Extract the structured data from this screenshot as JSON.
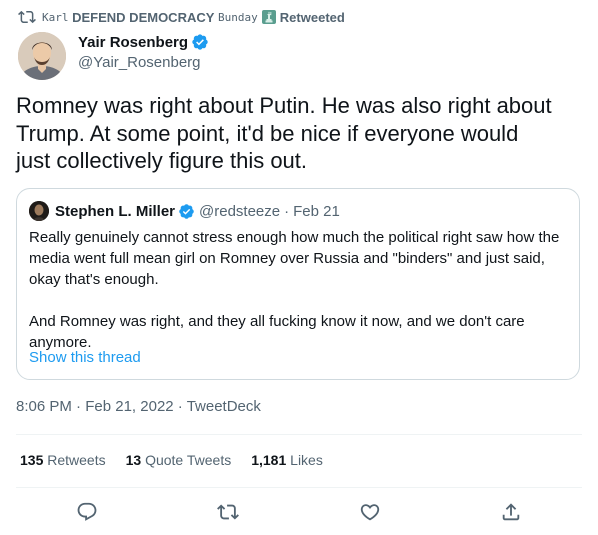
{
  "retweet_banner": {
    "name_prefix": "Karl",
    "name_main": "DEFEND DEMOCRACY",
    "name_suffix": "Bunday",
    "action": "Retweeted"
  },
  "author": {
    "name": "Yair Rosenberg",
    "handle": "@Yair_Rosenberg",
    "verified": true
  },
  "tweet": {
    "text": "Romney was right about Putin. He was also right about\nTrump. At some point, it'd be nice if everyone would\njust collectively figure this out.",
    "time": "8:06 PM",
    "date": "Feb 21, 2022",
    "source": "TweetDeck",
    "separator": "·"
  },
  "quoted": {
    "name": "Stephen L. Miller",
    "handle": "@redsteeze",
    "date": "Feb 21",
    "separator": "·",
    "paragraph_1": "Really genuinely cannot stress enough how much the political right saw how the media went full mean girl on Romney over Russia and \"binders\" and just said, okay that's enough.",
    "paragraph_2": "And Romney was right, and they all fucking know it now, and we don't care anymore.",
    "thread_link": "Show this thread"
  },
  "stats": {
    "retweets_count": "135",
    "retweets_label": "Retweets",
    "quotes_count": "13",
    "quotes_label": "Quote Tweets",
    "likes_count": "1,181",
    "likes_label": "Likes"
  },
  "colors": {
    "accent": "#1d9bf0",
    "muted": "#536471",
    "text": "#0f1419",
    "border": "#cfd9de"
  },
  "icons": {
    "retweet_banner": "retweet-icon",
    "statue": "statue-of-liberty-icon",
    "verified": "verified-badge-icon",
    "reply": "reply-icon",
    "retweet": "retweet-icon",
    "like": "heart-icon",
    "share": "share-icon"
  }
}
